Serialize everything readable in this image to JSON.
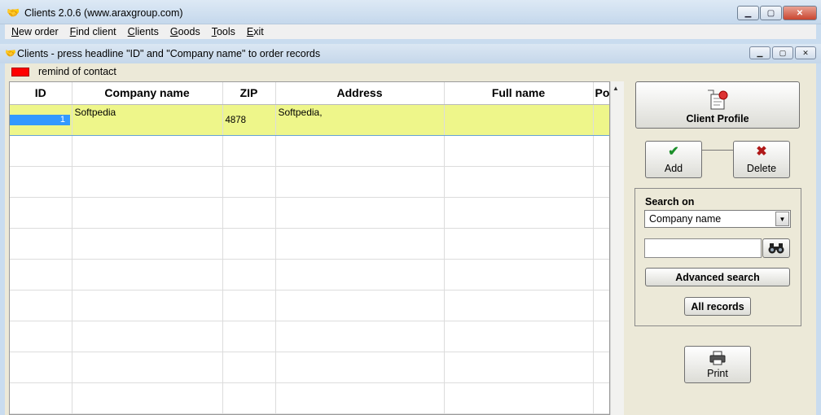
{
  "window": {
    "title": "Clients 2.0.6 (www.araxgroup.com)",
    "controls": {
      "minimize": "▁",
      "maximize": "▢",
      "close": "✕"
    }
  },
  "menu": {
    "items": [
      {
        "ul": "N",
        "rest": "ew order"
      },
      {
        "ul": "F",
        "rest": "ind client"
      },
      {
        "ul": "C",
        "rest": "lients"
      },
      {
        "ul": "G",
        "rest": "oods"
      },
      {
        "ul": "T",
        "rest": "ools"
      },
      {
        "ul": "E",
        "rest": "xit"
      }
    ]
  },
  "inner_window": {
    "title": "Clients - press headline \"ID\" and \"Company name\" to order records",
    "controls": {
      "minimize": "▁",
      "maximize": "▢",
      "close": "✕"
    }
  },
  "legend": {
    "remind_label": "remind of contact",
    "remind_color": "#ff0000"
  },
  "grid": {
    "columns": [
      "ID",
      "Company name",
      "ZIP",
      "Address",
      "Full name",
      "Pos"
    ],
    "rows": [
      {
        "id": "1",
        "company": "Softpedia",
        "zip": "4878",
        "address": "Softpedia,",
        "full_name": "",
        "pos": ""
      }
    ],
    "selected_row_color": "#eef68a"
  },
  "panel": {
    "client_profile_label": "Client Profile",
    "add_label": "Add",
    "delete_label": "Delete",
    "search_on_label": "Search on",
    "search_field_value": "Company name",
    "search_input_value": "",
    "advanced_search_label": "Advanced search",
    "all_records_label": "All records",
    "print_label": "Print"
  },
  "icons": {
    "app": "handshake-icon",
    "check": "✔",
    "cross": "✖",
    "scroll_up": "▲",
    "dropdown": "▼"
  }
}
